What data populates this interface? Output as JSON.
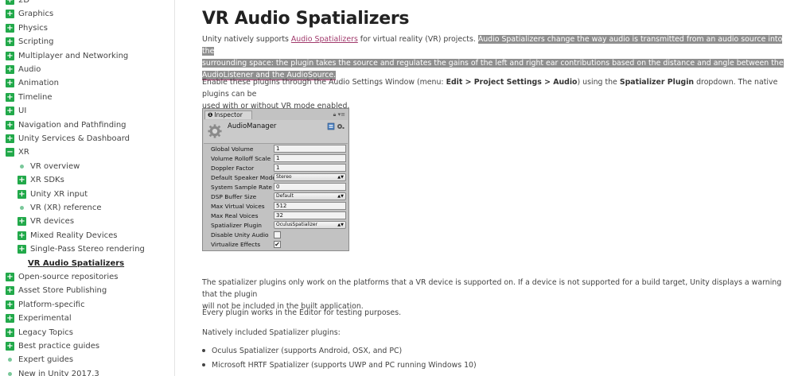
{
  "sidebar": {
    "items": [
      {
        "label": "2D",
        "type": "plus"
      },
      {
        "label": "Graphics",
        "type": "plus"
      },
      {
        "label": "Physics",
        "type": "plus"
      },
      {
        "label": "Scripting",
        "type": "plus"
      },
      {
        "label": "Multiplayer and Networking",
        "type": "plus"
      },
      {
        "label": "Audio",
        "type": "plus"
      },
      {
        "label": "Animation",
        "type": "plus"
      },
      {
        "label": "Timeline",
        "type": "plus"
      },
      {
        "label": "UI",
        "type": "plus"
      },
      {
        "label": "Navigation and Pathfinding",
        "type": "plus"
      },
      {
        "label": "Unity Services & Dashboard",
        "type": "plus"
      },
      {
        "label": "XR",
        "type": "minus"
      },
      {
        "label": "VR overview",
        "type": "dot",
        "indent": 1
      },
      {
        "label": "XR SDKs",
        "type": "plus",
        "indent": 1
      },
      {
        "label": "Unity XR input",
        "type": "plus",
        "indent": 1
      },
      {
        "label": "VR (XR) reference",
        "type": "dot",
        "indent": 1
      },
      {
        "label": "VR devices",
        "type": "plus",
        "indent": 1
      },
      {
        "label": "Mixed Reality Devices",
        "type": "plus",
        "indent": 1
      },
      {
        "label": "Single-Pass Stereo rendering",
        "type": "plus",
        "indent": 1
      },
      {
        "label": "VR Audio Spatializers",
        "type": "current",
        "indent": 1
      },
      {
        "label": "Open-source repositories",
        "type": "plus"
      },
      {
        "label": "Asset Store Publishing",
        "type": "plus"
      },
      {
        "label": "Platform-specific",
        "type": "plus"
      },
      {
        "label": "Experimental",
        "type": "plus"
      },
      {
        "label": "Legacy Topics",
        "type": "plus"
      },
      {
        "label": "Best practice guides",
        "type": "plus"
      },
      {
        "label": "Expert guides",
        "type": "dot"
      },
      {
        "label": "New in Unity 2017.3",
        "type": "dot"
      }
    ]
  },
  "main": {
    "title": "VR Audio Spatializers",
    "intro": {
      "before_link": "Unity natively supports ",
      "link": "Audio Spatializers",
      "after_link": " for virtual reality (VR) projects. ",
      "hl_line1": "Audio Spatializers change the way audio is transmitted from an audio source into the",
      "hl_line2": "surrounding space: the plugin takes the source and regulates the gains of the left and right ear contributions based on the distance and angle between the",
      "hl_line3": "AudioListener and the AudioSource."
    },
    "enable": {
      "t1": "Enable these plugins through the Audio Settings Window (menu: ",
      "b1": "Edit > Project Settings > Audio",
      "t2": ") using the ",
      "b2": "Spatializer Plugin",
      "t3": " dropdown. The native plugins can be",
      "line2": "used with or without VR mode enabled."
    },
    "inspector": {
      "tab": "Inspector",
      "tab_icon": "info-icon",
      "component": "AudioManager",
      "rows": [
        {
          "label": "Global Volume",
          "kind": "field",
          "value": "1"
        },
        {
          "label": "Volume Rolloff Scale",
          "kind": "field",
          "value": "1"
        },
        {
          "label": "Doppler Factor",
          "kind": "field",
          "value": "1"
        },
        {
          "label": "Default Speaker Mode",
          "kind": "dropdown",
          "value": "Stereo"
        },
        {
          "label": "System Sample Rate",
          "kind": "field",
          "value": "0"
        },
        {
          "label": "DSP Buffer Size",
          "kind": "dropdown",
          "value": "Default"
        },
        {
          "label": "Max Virtual Voices",
          "kind": "field",
          "value": "512"
        },
        {
          "label": "Max Real Voices",
          "kind": "field",
          "value": "32"
        },
        {
          "label": "Spatializer Plugin",
          "kind": "dropdown",
          "value": "OculusSpatializer"
        },
        {
          "label": "Disable Unity Audio",
          "kind": "checkbox",
          "checked": false
        },
        {
          "label": "Virtualize Effects",
          "kind": "checkbox",
          "checked": true
        }
      ]
    },
    "p_platform_1": "The spatializer plugins only work on the platforms that a VR device is supported on. If a device is not supported for a build target, Unity displays a warning that the plugin",
    "p_platform_2": "will not be included in the built application.",
    "p_editor": "Every plugin works in the Editor for testing purposes.",
    "p_native": "Natively included Spatializer plugins:",
    "bullets": [
      "Oculus Spatializer (supports Android, OSX, and PC)",
      "Microsoft HRTF Spatializer (supports UWP and PC running Windows 10)"
    ]
  },
  "colors": {
    "accent_green": "#22a94a",
    "link": "#a0396b",
    "highlight": "#8f8f8f"
  }
}
